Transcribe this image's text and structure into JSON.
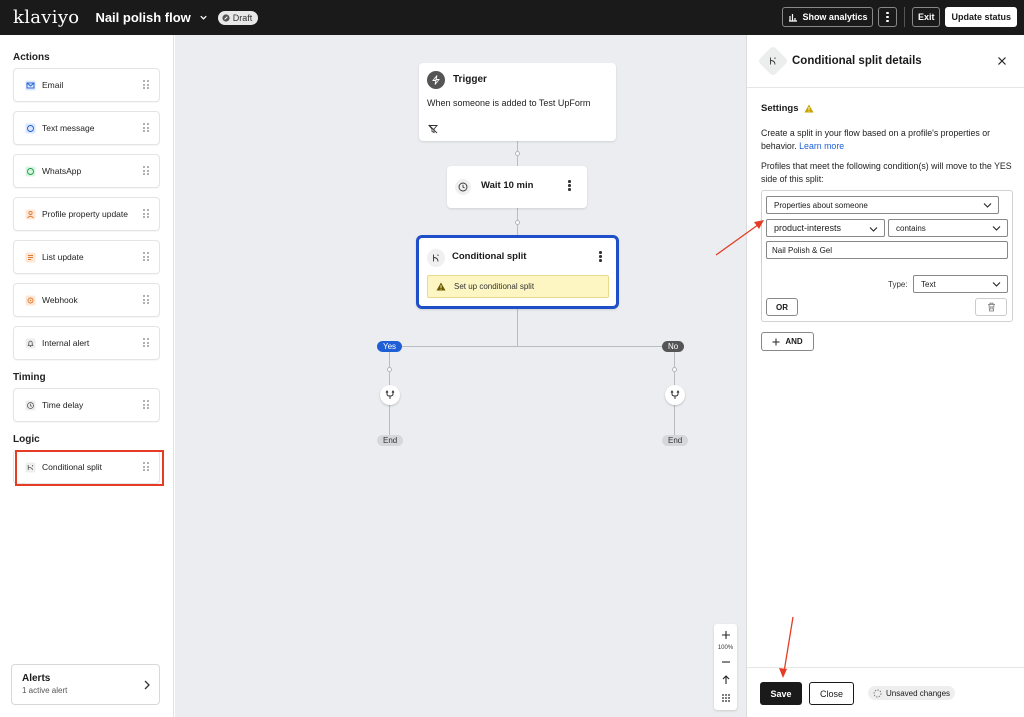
{
  "topbar": {
    "logo": "klaviyo",
    "flow_title": "Nail polish flow",
    "draft_badge": "Draft",
    "show_analytics": "Show analytics",
    "exit": "Exit",
    "update_status": "Update status"
  },
  "sidebar": {
    "actions_title": "Actions",
    "timing_title": "Timing",
    "logic_title": "Logic",
    "actions": [
      {
        "label": "Email",
        "icon": "mail-icon"
      },
      {
        "label": "Text message",
        "icon": "sms-icon"
      },
      {
        "label": "WhatsApp",
        "icon": "whatsapp-icon"
      },
      {
        "label": "Profile property update",
        "icon": "profile-icon"
      },
      {
        "label": "List update",
        "icon": "list-icon"
      },
      {
        "label": "Webhook",
        "icon": "webhook-icon"
      },
      {
        "label": "Internal alert",
        "icon": "bell-icon"
      }
    ],
    "timing": [
      {
        "label": "Time delay",
        "icon": "clock-icon"
      }
    ],
    "logic": [
      {
        "label": "Conditional split",
        "icon": "split-icon"
      }
    ],
    "alerts": {
      "title": "Alerts",
      "subtitle": "1 active alert"
    }
  },
  "canvas": {
    "trigger": {
      "title": "Trigger",
      "description": "When someone is added to Test UpForm"
    },
    "wait": {
      "title": "Wait 10 min"
    },
    "split": {
      "title": "Conditional split",
      "warning": "Set up conditional split"
    },
    "yes_label": "Yes",
    "no_label": "No",
    "end_label": "End",
    "zoom": "100%"
  },
  "panel": {
    "title": "Conditional split details",
    "settings_label": "Settings",
    "description": "Create a split in your flow based on a profile's properties or behavior.",
    "learn_more": "Learn more",
    "condition_text": "Profiles that meet the following condition(s) will move to the YES side of this split:",
    "condition": {
      "category": "Properties about someone",
      "property": "product-interests",
      "operator": "contains",
      "value": "Nail Polish & Gel",
      "type_label": "Type:",
      "type_value": "Text"
    },
    "or_label": "OR",
    "and_label": "AND",
    "save": "Save",
    "close": "Close",
    "unsaved": "Unsaved changes"
  },
  "colors": {
    "accent_blue": "#1f4fc8",
    "highlight_red": "#e53d25",
    "warning_yellow": "#fdf6c3"
  }
}
